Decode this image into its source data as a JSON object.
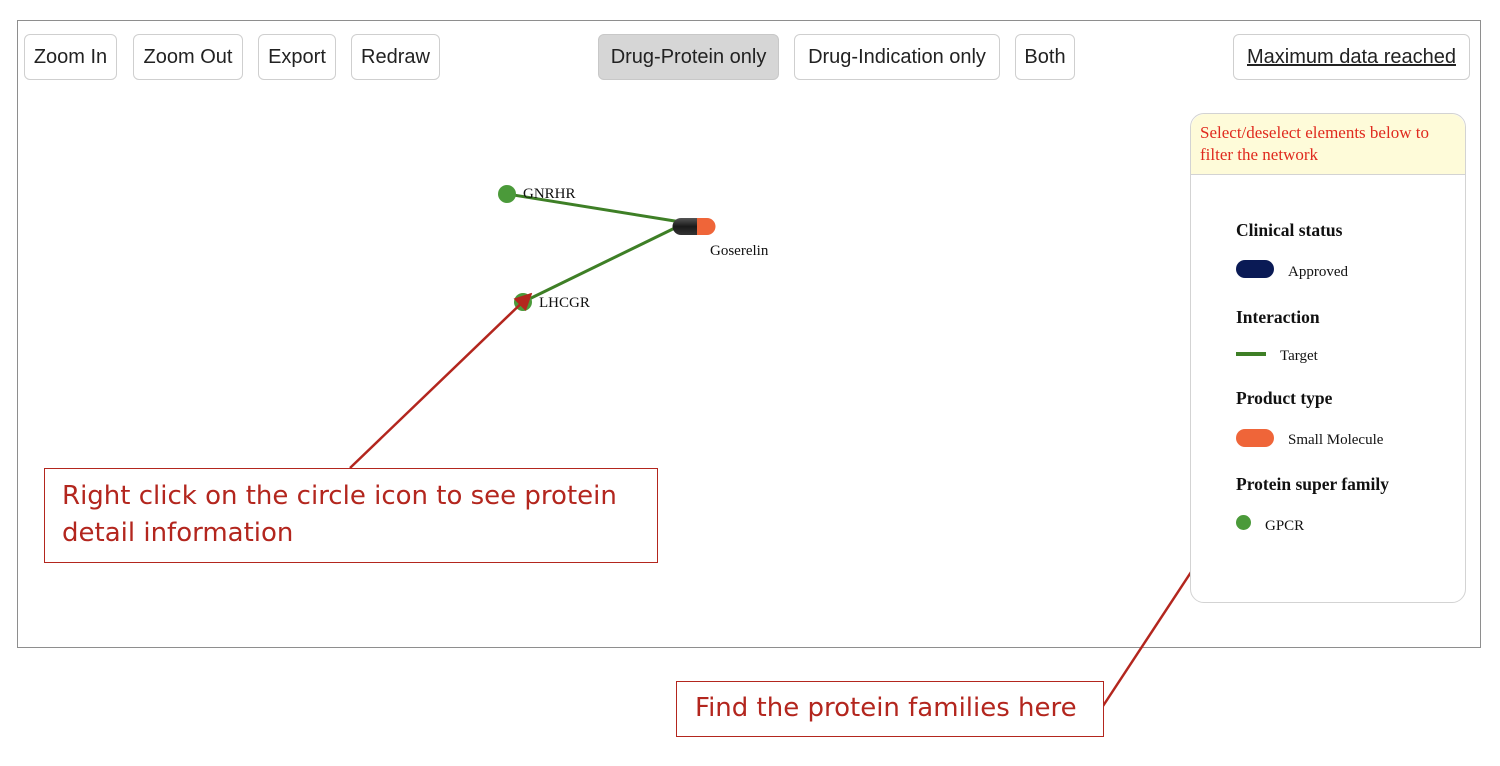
{
  "toolbar": {
    "zoom_in": "Zoom In",
    "zoom_out": "Zoom Out",
    "export": "Export",
    "redraw": "Redraw",
    "drug_protein_only": "Drug-Protein only",
    "drug_indication_only": "Drug-Indication only",
    "both": "Both",
    "maximum_data": "Maximum data reached",
    "active_filter": "Drug-Protein only"
  },
  "network": {
    "nodes": {
      "gnrhr": "GNRHR",
      "lhcgr": "LHCGR",
      "goserelin": "Goserelin"
    }
  },
  "legend": {
    "hint": "Select/deselect elements below to filter the network",
    "clinical_status": {
      "heading": "Clinical status",
      "item": "Approved",
      "color": "#0a1a55"
    },
    "interaction": {
      "heading": "Interaction",
      "item": "Target",
      "color": "#3e7f26"
    },
    "product_type": {
      "heading": "Product type",
      "item": "Small Molecule",
      "color": "#ef6539"
    },
    "protein_super_family": {
      "heading": "Protein super family",
      "item": "GPCR",
      "color": "#4b9a3a"
    }
  },
  "annotations": {
    "protein_hint": "Right click on the circle icon to see protein detail information",
    "family_hint": "Find the protein families here",
    "color": "#b3261e"
  }
}
